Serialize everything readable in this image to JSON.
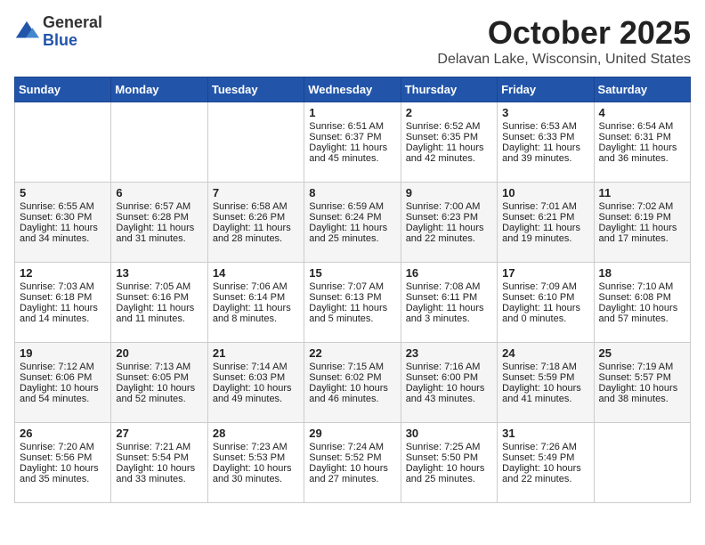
{
  "header": {
    "logo_line1": "General",
    "logo_line2": "Blue",
    "month_title": "October 2025",
    "location": "Delavan Lake, Wisconsin, United States"
  },
  "days_of_week": [
    "Sunday",
    "Monday",
    "Tuesday",
    "Wednesday",
    "Thursday",
    "Friday",
    "Saturday"
  ],
  "weeks": [
    [
      {
        "day": "",
        "info": ""
      },
      {
        "day": "",
        "info": ""
      },
      {
        "day": "",
        "info": ""
      },
      {
        "day": "1",
        "info": "Sunrise: 6:51 AM\nSunset: 6:37 PM\nDaylight: 11 hours and 45 minutes."
      },
      {
        "day": "2",
        "info": "Sunrise: 6:52 AM\nSunset: 6:35 PM\nDaylight: 11 hours and 42 minutes."
      },
      {
        "day": "3",
        "info": "Sunrise: 6:53 AM\nSunset: 6:33 PM\nDaylight: 11 hours and 39 minutes."
      },
      {
        "day": "4",
        "info": "Sunrise: 6:54 AM\nSunset: 6:31 PM\nDaylight: 11 hours and 36 minutes."
      }
    ],
    [
      {
        "day": "5",
        "info": "Sunrise: 6:55 AM\nSunset: 6:30 PM\nDaylight: 11 hours and 34 minutes."
      },
      {
        "day": "6",
        "info": "Sunrise: 6:57 AM\nSunset: 6:28 PM\nDaylight: 11 hours and 31 minutes."
      },
      {
        "day": "7",
        "info": "Sunrise: 6:58 AM\nSunset: 6:26 PM\nDaylight: 11 hours and 28 minutes."
      },
      {
        "day": "8",
        "info": "Sunrise: 6:59 AM\nSunset: 6:24 PM\nDaylight: 11 hours and 25 minutes."
      },
      {
        "day": "9",
        "info": "Sunrise: 7:00 AM\nSunset: 6:23 PM\nDaylight: 11 hours and 22 minutes."
      },
      {
        "day": "10",
        "info": "Sunrise: 7:01 AM\nSunset: 6:21 PM\nDaylight: 11 hours and 19 minutes."
      },
      {
        "day": "11",
        "info": "Sunrise: 7:02 AM\nSunset: 6:19 PM\nDaylight: 11 hours and 17 minutes."
      }
    ],
    [
      {
        "day": "12",
        "info": "Sunrise: 7:03 AM\nSunset: 6:18 PM\nDaylight: 11 hours and 14 minutes."
      },
      {
        "day": "13",
        "info": "Sunrise: 7:05 AM\nSunset: 6:16 PM\nDaylight: 11 hours and 11 minutes."
      },
      {
        "day": "14",
        "info": "Sunrise: 7:06 AM\nSunset: 6:14 PM\nDaylight: 11 hours and 8 minutes."
      },
      {
        "day": "15",
        "info": "Sunrise: 7:07 AM\nSunset: 6:13 PM\nDaylight: 11 hours and 5 minutes."
      },
      {
        "day": "16",
        "info": "Sunrise: 7:08 AM\nSunset: 6:11 PM\nDaylight: 11 hours and 3 minutes."
      },
      {
        "day": "17",
        "info": "Sunrise: 7:09 AM\nSunset: 6:10 PM\nDaylight: 11 hours and 0 minutes."
      },
      {
        "day": "18",
        "info": "Sunrise: 7:10 AM\nSunset: 6:08 PM\nDaylight: 10 hours and 57 minutes."
      }
    ],
    [
      {
        "day": "19",
        "info": "Sunrise: 7:12 AM\nSunset: 6:06 PM\nDaylight: 10 hours and 54 minutes."
      },
      {
        "day": "20",
        "info": "Sunrise: 7:13 AM\nSunset: 6:05 PM\nDaylight: 10 hours and 52 minutes."
      },
      {
        "day": "21",
        "info": "Sunrise: 7:14 AM\nSunset: 6:03 PM\nDaylight: 10 hours and 49 minutes."
      },
      {
        "day": "22",
        "info": "Sunrise: 7:15 AM\nSunset: 6:02 PM\nDaylight: 10 hours and 46 minutes."
      },
      {
        "day": "23",
        "info": "Sunrise: 7:16 AM\nSunset: 6:00 PM\nDaylight: 10 hours and 43 minutes."
      },
      {
        "day": "24",
        "info": "Sunrise: 7:18 AM\nSunset: 5:59 PM\nDaylight: 10 hours and 41 minutes."
      },
      {
        "day": "25",
        "info": "Sunrise: 7:19 AM\nSunset: 5:57 PM\nDaylight: 10 hours and 38 minutes."
      }
    ],
    [
      {
        "day": "26",
        "info": "Sunrise: 7:20 AM\nSunset: 5:56 PM\nDaylight: 10 hours and 35 minutes."
      },
      {
        "day": "27",
        "info": "Sunrise: 7:21 AM\nSunset: 5:54 PM\nDaylight: 10 hours and 33 minutes."
      },
      {
        "day": "28",
        "info": "Sunrise: 7:23 AM\nSunset: 5:53 PM\nDaylight: 10 hours and 30 minutes."
      },
      {
        "day": "29",
        "info": "Sunrise: 7:24 AM\nSunset: 5:52 PM\nDaylight: 10 hours and 27 minutes."
      },
      {
        "day": "30",
        "info": "Sunrise: 7:25 AM\nSunset: 5:50 PM\nDaylight: 10 hours and 25 minutes."
      },
      {
        "day": "31",
        "info": "Sunrise: 7:26 AM\nSunset: 5:49 PM\nDaylight: 10 hours and 22 minutes."
      },
      {
        "day": "",
        "info": ""
      }
    ]
  ]
}
